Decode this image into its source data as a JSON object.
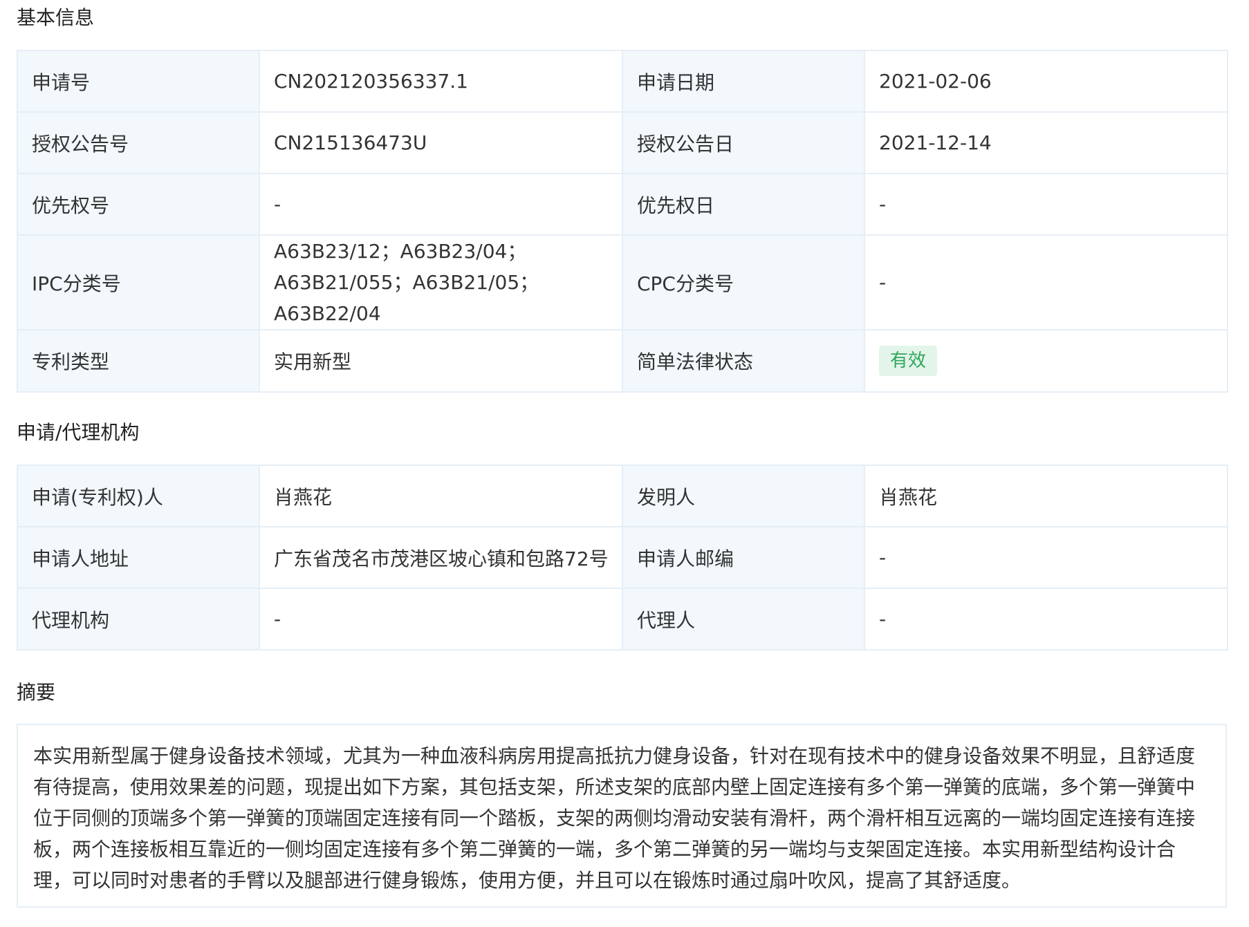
{
  "basic": {
    "title": "基本信息",
    "rows": [
      [
        {
          "label": "申请号",
          "value": "CN202120356337.1"
        },
        {
          "label": "申请日期",
          "value": "2021-02-06"
        }
      ],
      [
        {
          "label": "授权公告号",
          "value": "CN215136473U"
        },
        {
          "label": "授权公告日",
          "value": "2021-12-14"
        }
      ],
      [
        {
          "label": "优先权号",
          "value": "-"
        },
        {
          "label": "优先权日",
          "value": "-"
        }
      ],
      [
        {
          "label": "IPC分类号",
          "value": "A63B23/12；A63B23/04；A63B21/055；A63B21/05；A63B22/04"
        },
        {
          "label": "CPC分类号",
          "value": "-"
        }
      ],
      [
        {
          "label": "专利类型",
          "value": "实用新型"
        },
        {
          "label": "简单法律状态",
          "value": "有效"
        }
      ]
    ]
  },
  "agency": {
    "title": "申请/代理机构",
    "rows": [
      [
        {
          "label": "申请(专利权)人",
          "value": "肖燕花"
        },
        {
          "label": "发明人",
          "value": "肖燕花"
        }
      ],
      [
        {
          "label": "申请人地址",
          "value": "广东省茂名市茂港区坡心镇和包路72号"
        },
        {
          "label": "申请人邮编",
          "value": "-"
        }
      ],
      [
        {
          "label": "代理机构",
          "value": "-"
        },
        {
          "label": "代理人",
          "value": "-"
        }
      ]
    ]
  },
  "abstract": {
    "title": "摘要",
    "text": "本实用新型属于健身设备技术领域，尤其为一种血液科病房用提高抵抗力健身设备，针对在现有技术中的健身设备效果不明显，且舒适度有待提高，使用效果差的问题，现提出如下方案，其包括支架，所述支架的底部内壁上固定连接有多个第一弹簧的底端，多个第一弹簧中位于同侧的顶端多个第一弹簧的顶端固定连接有同一个踏板，支架的两侧均滑动安装有滑杆，两个滑杆相互远离的一端均固定连接有连接板，两个连接板相互靠近的一侧均固定连接有多个第二弹簧的一端，多个第二弹簧的另一端均与支架固定连接。本实用新型结构设计合理，可以同时对患者的手臂以及腿部进行健身锻炼，使用方便，并且可以在锻炼时通过扇叶吹风，提高了其舒适度。"
  },
  "colors": {
    "label_bg": "#f2f8fc",
    "border": "#e6eef6",
    "badge_bg": "#e3f5ea",
    "badge_text": "#2ea65a"
  }
}
